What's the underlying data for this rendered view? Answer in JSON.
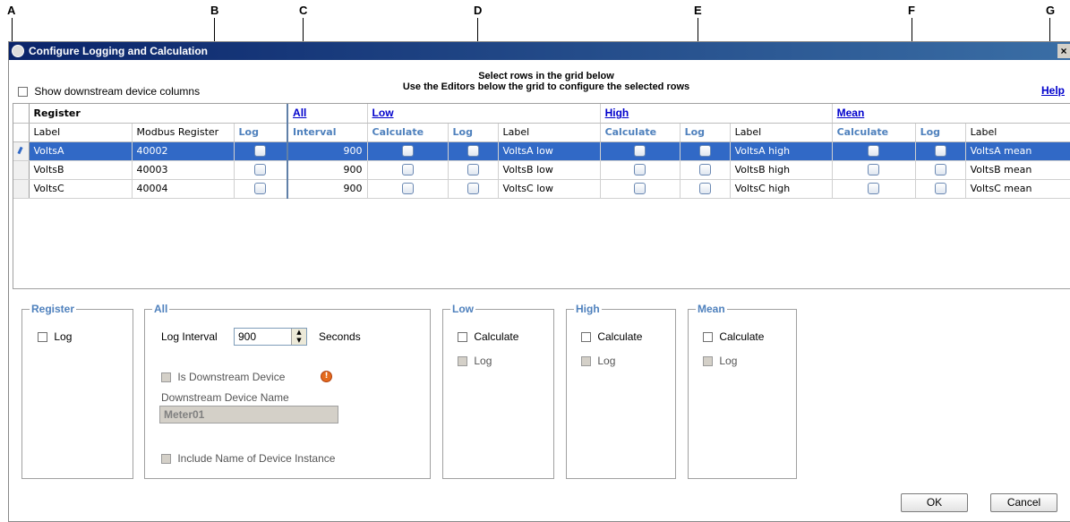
{
  "callouts": [
    "A",
    "B",
    "C",
    "D",
    "E",
    "F",
    "G"
  ],
  "window": {
    "title": "Configure Logging and Calculation",
    "close_label": "×"
  },
  "toolbar": {
    "show_downstream_label": "Show downstream device columns",
    "instruction_line1": "Select rows in the grid below",
    "instruction_line2": "Use the Editors below the grid to configure the selected rows",
    "help_label": "Help"
  },
  "grid": {
    "groups": {
      "register": "Register",
      "all": "All",
      "low": "Low",
      "high": "High",
      "mean": "Mean"
    },
    "columns": {
      "label": "Label",
      "modbus": "Modbus Register",
      "log": "Log",
      "interval": "Interval",
      "calculate": "Calculate"
    },
    "rows": [
      {
        "label": "VoltsA",
        "modbus": "40002",
        "interval": "900",
        "low_label": "VoltsA low",
        "high_label": "VoltsA high",
        "mean_label": "VoltsA mean"
      },
      {
        "label": "VoltsB",
        "modbus": "40003",
        "interval": "900",
        "low_label": "VoltsB low",
        "high_label": "VoltsB high",
        "mean_label": "VoltsB mean"
      },
      {
        "label": "VoltsC",
        "modbus": "40004",
        "interval": "900",
        "low_label": "VoltsC low",
        "high_label": "VoltsC high",
        "mean_label": "VoltsC mean"
      }
    ]
  },
  "editors": {
    "register": {
      "legend": "Register",
      "log_label": "Log"
    },
    "all": {
      "legend": "All",
      "log_interval_label": "Log Interval",
      "log_interval_value": "900",
      "seconds_label": "Seconds",
      "is_downstream_label": "Is Downstream Device",
      "downstream_name_label": "Downstream Device Name",
      "downstream_name_value": "Meter01",
      "include_instance_label": "Include Name of Device Instance"
    },
    "low": {
      "legend": "Low",
      "calculate_label": "Calculate",
      "log_label": "Log"
    },
    "high": {
      "legend": "High",
      "calculate_label": "Calculate",
      "log_label": "Log"
    },
    "mean": {
      "legend": "Mean",
      "calculate_label": "Calculate",
      "log_label": "Log"
    }
  },
  "buttons": {
    "ok": "OK",
    "cancel": "Cancel"
  }
}
